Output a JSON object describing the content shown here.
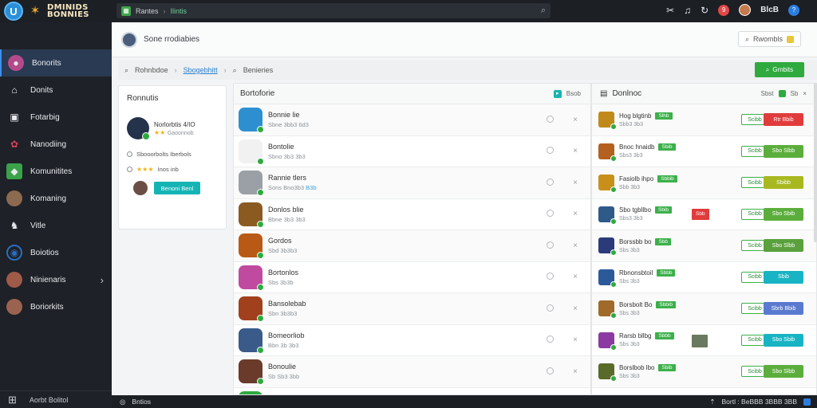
{
  "app": {
    "badge": "U",
    "logo_line1": "DMINIDS",
    "logo_line2": "BONNIES"
  },
  "topbar": {
    "crumb1": "Rantes",
    "crumb2": "Ilintis",
    "icons": [
      "puzzle-icon",
      "bell-icon",
      "refresh-icon",
      "avatar",
      "user-icon"
    ],
    "notif_count": "9",
    "user_label": "BlcB",
    "help": "?"
  },
  "sidebar": {
    "items": [
      {
        "label": "Bonorits",
        "icon": "user-icon",
        "color": "#b54a8a"
      },
      {
        "label": "Donits",
        "icon": "home-icon",
        "color": "#6c7480"
      },
      {
        "label": "Fotarbig",
        "icon": "briefcase-icon",
        "color": "#6c7480"
      },
      {
        "label": "Nanodiing",
        "icon": "game-icon",
        "color": "#d8405a"
      },
      {
        "label": "Komunitites",
        "icon": "people-icon",
        "color": "#3aa24a"
      },
      {
        "label": "Komaning",
        "icon": "avatar-icon",
        "color": "#8c6a50"
      },
      {
        "label": "Vitle",
        "icon": "character-icon",
        "color": "#4a4f58"
      },
      {
        "label": "Boiotios",
        "icon": "circle-icon",
        "color": "#2b6ec0"
      },
      {
        "label": "Ninienaris",
        "icon": "avatar-icon",
        "color": "#a05a48"
      },
      {
        "label": "Boriorkits",
        "icon": "avatar-icon",
        "color": "#9c6250"
      }
    ],
    "bottom_label": "Aorbt Bolitol"
  },
  "header": {
    "title": "Sone rrodiabies",
    "button": "Rwombls"
  },
  "crumbs": {
    "item1": "Rohnbdoe",
    "item2": "Sbogebhitt",
    "item3": "Benieries",
    "action": "Grnbits"
  },
  "left_card": {
    "title": "Ronnutis",
    "profile_name": "Norlorbtis 4/IO",
    "stars": "★★",
    "rating_text": "Gaoonnob",
    "line1": "Sbooorbolts Iberbols",
    "line2_stars": "★★★",
    "line2_text": "Inos inb",
    "button": "Benoni Benl"
  },
  "middle": {
    "title": "Bortoforie",
    "head_right": "Bsob",
    "rows": [
      {
        "name": "Bonnie lie",
        "sub": "Sbne 3bb3 6d3",
        "hl": "",
        "color": "#2e8fd0"
      },
      {
        "name": "Bontolie",
        "sub": "Sbno 3b3 3b3",
        "hl": "",
        "color": "#f1f1f1"
      },
      {
        "name": "Rannie tlers",
        "sub": "Sons Bno3b3",
        "hl": "B3b",
        "color": "#9aa0a6"
      },
      {
        "name": "Donlos blie",
        "sub": "Bbne 3b3 3b3",
        "hl": "",
        "color": "#8a5a20"
      },
      {
        "name": "Gordos",
        "sub": "Sbd 3b3b3",
        "hl": "",
        "color": "#b85a16"
      },
      {
        "name": "Bortonlos",
        "sub": "Sbs 3b3b",
        "hl": "",
        "color": "#c04aa0"
      },
      {
        "name": "Bansolebab",
        "sub": "Sbn 3b3b3",
        "hl": "",
        "color": "#a0401c"
      },
      {
        "name": "Bomeorliob",
        "sub": "Bbn 3b 3b3",
        "hl": "",
        "color": "#3a5a8a"
      },
      {
        "name": "Bonoulie",
        "sub": "Sb Sb3 3bb",
        "hl": "",
        "color": "#6a3a2a"
      },
      {
        "name": "",
        "sub": "",
        "hl": "",
        "color": "#2eaa3e"
      }
    ]
  },
  "right": {
    "title": "Donlnoc",
    "head_right": "Sbst",
    "head_right2": "Sb",
    "rows": [
      {
        "name": "Hog blgtinb",
        "sub": "Sbb3 3b3",
        "tag": "Slhb",
        "extra": "",
        "outline": "Scibb",
        "fill": "Rtr Bbib",
        "fill_color": "#e03c3c",
        "color": "#c08a1a"
      },
      {
        "name": "Bnoc hnaidb",
        "sub": "Sbs3 3b3",
        "tag": "Sbib",
        "extra": "",
        "outline": "Scibb",
        "fill": "Sbo Slbb",
        "fill_color": "#5cae3c",
        "color": "#b4601e"
      },
      {
        "name": "Fasiolb ihpo",
        "sub": "Sbb 3b3",
        "tag": "Sbbib",
        "extra": "",
        "outline": "Scibb",
        "fill": "Sbibb",
        "fill_color": "#a8b820",
        "color": "#c8901a"
      },
      {
        "name": "Sbo tgbllbo",
        "sub": "Sbs3 3b3",
        "tag": "Sbib",
        "extra": "Sbb",
        "outline": "Scibb",
        "fill": "Sbo Sbib",
        "fill_color": "#5cae3c",
        "color": "#2e5a8a"
      },
      {
        "name": "Borssbb bo",
        "sub": "Sbs 3b3",
        "tag": "Sbb",
        "extra": "",
        "outline": "Scibb",
        "fill": "Sbo Slbb",
        "fill_color": "#5aa03c",
        "color": "#2a3a7a"
      },
      {
        "name": "Rbnonsbtoil",
        "sub": "Sbs 3b3",
        "tag": "Sbbb",
        "extra": "",
        "outline": "Scibb",
        "fill": "Sbib",
        "fill_color": "#18b4c4",
        "color": "#2a5a9a"
      },
      {
        "name": "Borsbolt Bo",
        "sub": "Sbs 3b3",
        "tag": "Sbbib",
        "extra": "",
        "outline": "Scibb",
        "fill": "Sbrb Bbib",
        "fill_color": "#5a7ad0",
        "color": "#a06a2a"
      },
      {
        "name": "Rarsb bllbg",
        "sub": "Sbs 3b3",
        "tag": "Sbbb",
        "extra": "",
        "outline": "Scibb",
        "fill": "Sbo Sbib",
        "fill_color": "#18b4c4",
        "color": "#8a3aa0"
      },
      {
        "name": "Borslbob lbo",
        "sub": "Sbs 3b3",
        "tag": "Sbib",
        "extra": "",
        "outline": "Scibb",
        "fill": "Sbo Slbb",
        "fill_color": "#5cae3c",
        "color": "#5a6a2a"
      }
    ]
  },
  "status": {
    "label": "Bntios",
    "right_text": "Bortl : BeBBB 3BBB 3BB"
  }
}
